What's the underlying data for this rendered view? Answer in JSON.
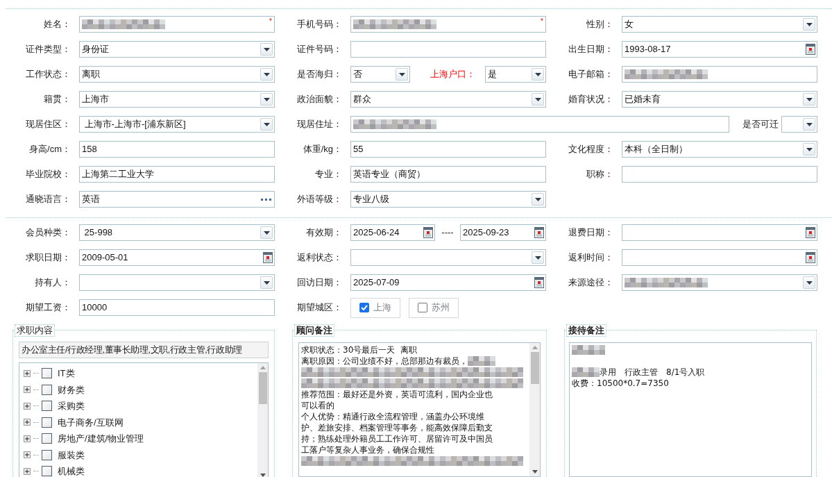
{
  "profile": [
    {
      "label": "姓名：",
      "kind": "text",
      "redacted": true,
      "required_mark": "*"
    },
    {
      "label": "手机号码：",
      "kind": "text",
      "redacted": true,
      "required_mark": "*"
    },
    {
      "label": "性别：",
      "kind": "select",
      "value": "女"
    },
    {
      "label": "证件类型：",
      "kind": "select",
      "value": "身份证"
    },
    {
      "label": "证件号码：",
      "kind": "text"
    },
    {
      "label": "出生日期：",
      "kind": "date",
      "value": "1993-08-17"
    },
    {
      "label": "工作状态：",
      "kind": "select",
      "value": "离职"
    },
    {
      "label": "是否海归：",
      "kind": "pair",
      "value": "否",
      "second_label": "上海户口：",
      "second_value": "是",
      "second_label_alert": true
    },
    {
      "label": "电子邮箱：",
      "kind": "text",
      "redacted": true
    },
    {
      "label": "籍贯：",
      "kind": "select",
      "value": "上海市"
    },
    {
      "label": "政治面貌：",
      "kind": "select",
      "value": "群众"
    },
    {
      "label": "婚育状况：",
      "kind": "select",
      "value": "已婚未育"
    },
    {
      "label": "现居住区：",
      "kind": "select",
      "value": " 上海市-上海市-[浦东新区]"
    },
    {
      "label": "现居住址：",
      "kind": "address",
      "redacted": true,
      "second_label": "是否可迁"
    },
    {
      "label": "身高/cm：",
      "kind": "text",
      "value": "158"
    },
    {
      "label": "体重/kg：",
      "kind": "text",
      "value": "55"
    },
    {
      "label": "文化程度：",
      "kind": "select",
      "value": "本科（全日制）"
    },
    {
      "label": "毕业院校：",
      "kind": "text",
      "value": "上海第二工业大学"
    },
    {
      "label": "专业：",
      "kind": "text",
      "value": "英语专业（商贸）"
    },
    {
      "label": "职称：",
      "kind": "text"
    },
    {
      "label": "通晓语言：",
      "kind": "lookup",
      "value": "英语"
    },
    {
      "label": "外语等级：",
      "kind": "select",
      "value": "专业八级"
    },
    {
      "kind": "empty"
    }
  ],
  "membership": [
    {
      "label": "会员种类：",
      "kind": "select",
      "value": " 25-998"
    },
    {
      "label": "有效期：",
      "kind": "daterange",
      "value": "2025-06-24",
      "separator": "----",
      "second_value": "2025-09-23"
    },
    {
      "label": "退费日期：",
      "kind": "date"
    },
    {
      "label": "求职日期：",
      "kind": "date",
      "value": "2009-05-01"
    },
    {
      "label": "返利状态：",
      "kind": "select"
    },
    {
      "label": "返利时间：",
      "kind": "date"
    },
    {
      "label": "持有人：",
      "kind": "select"
    },
    {
      "label": "回访日期：",
      "kind": "date",
      "value": "2025-07-09"
    },
    {
      "label": "来源途径：",
      "kind": "select",
      "redacted": true
    },
    {
      "label": "期望工资：",
      "kind": "text",
      "value": "10000"
    },
    {
      "label": "期望城区：",
      "kind": "checks",
      "options": [
        {
          "label": "上海",
          "checked": true
        },
        {
          "label": "苏州",
          "checked": false
        }
      ]
    },
    {
      "kind": "empty"
    }
  ],
  "job_content": {
    "title": "求职内容",
    "bold": false,
    "summary": "办公室主任/行政经理,董事长助理,文职,行政主管,行政助理",
    "tree": [
      {
        "label": "IT类",
        "expanded": false,
        "checked": false
      },
      {
        "label": "财务类",
        "expanded": false,
        "checked": false
      },
      {
        "label": "采购类",
        "expanded": false,
        "checked": false
      },
      {
        "label": "电子商务/互联网",
        "expanded": false,
        "checked": false
      },
      {
        "label": "房地产/建筑/物业管理",
        "expanded": false,
        "checked": false
      },
      {
        "label": "服装类",
        "expanded": false,
        "checked": false
      },
      {
        "label": "机械类",
        "expanded": false,
        "checked": false
      }
    ]
  },
  "consultant_notes": {
    "title": "顾问备注",
    "bold": true,
    "lines": [
      {
        "kind": "text",
        "text": "求职状态：30号最后一天  离职"
      },
      {
        "kind": "redacted_tail",
        "text": "离职原因：公司业绩不好，总部那边有裁员，"
      },
      {
        "kind": "redacted_line"
      },
      {
        "kind": "redacted_line"
      },
      {
        "kind": "text",
        "text": "推荐范围：最好还是外资，英语可流利，国内企业也"
      },
      {
        "kind": "text",
        "text": "可以看的"
      },
      {
        "kind": "text",
        "text": "个人优势：精通行政全流程管理，涵盖办公环境维"
      },
      {
        "kind": "text",
        "text": "护、差旅安排、档案管理等事务，能高效保障后勤支"
      },
      {
        "kind": "text",
        "text": "持；熟练处理外籍员工工作许可、居留许可及中国员"
      },
      {
        "kind": "text",
        "text": "工落户等复杂人事业务，确保合规性"
      },
      {
        "kind": "redacted_line"
      }
    ]
  },
  "reception_notes": {
    "title": "接待备注",
    "bold": true,
    "lines": [
      {
        "kind": "redacted_word"
      },
      {
        "kind": "blank"
      },
      {
        "kind": "redacted_head",
        "text": "录用　行政主管　8/1号入职"
      },
      {
        "kind": "text",
        "text": "收费：10500*0.7=7350"
      }
    ]
  }
}
